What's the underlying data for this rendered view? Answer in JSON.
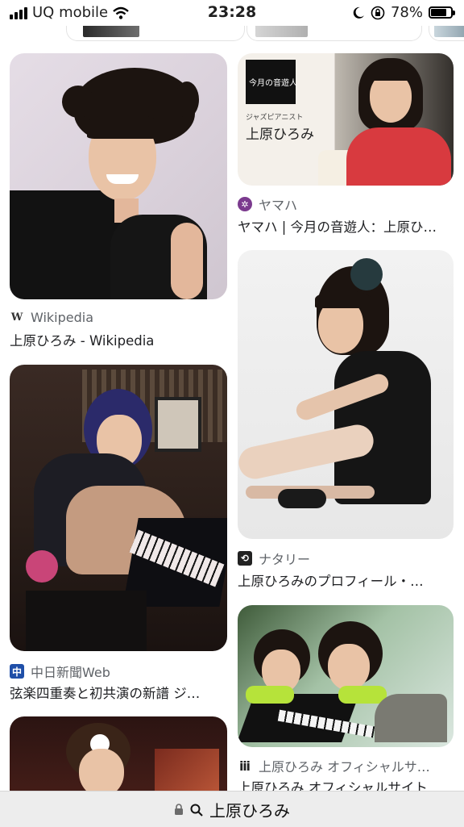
{
  "status_bar": {
    "carrier": "UQ mobile",
    "time": "23:28",
    "battery": "78%",
    "battery_level": 0.78
  },
  "results": [
    {
      "source": "Wikipedia",
      "title": "上原ひろみ - Wikipedia",
      "icon": "wikipedia-w-icon"
    },
    {
      "source": "ヤマハ",
      "title": "ヤマハ | 今月の音遊人：上原ひ…",
      "icon": "yamaha-logo-icon",
      "image_text": {
        "heading": "今月の音遊人",
        "sub": "ジャズピアニスト",
        "name": "上原ひろみ"
      }
    },
    {
      "source": "中日新聞Web",
      "title": "弦楽四重奏と初共演の新譜 ジ…",
      "icon": "chunichi-logo-icon"
    },
    {
      "source": "ナタリー",
      "title": "上原ひろみのプロフィール・…",
      "icon": "natalie-logo-icon"
    },
    {
      "source": "上原ひろみ オフィシャルサ…",
      "title": "上原ひろみ オフィシャルサイト",
      "icon": "official-site-icon"
    }
  ],
  "url_bar": {
    "text": "上原ひろみ"
  }
}
